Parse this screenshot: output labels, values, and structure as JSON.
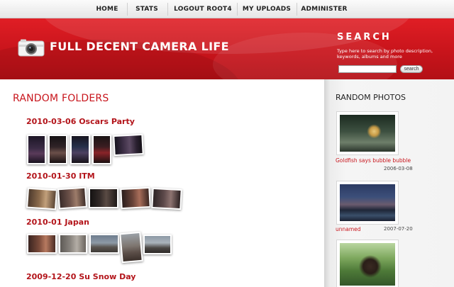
{
  "nav": {
    "items": [
      "HOME",
      "STATS",
      "LOGOUT ROOT4",
      "MY UPLOADS",
      "ADMINISTER"
    ]
  },
  "header": {
    "site_title": "FULL DECENT CAMERA LIFE",
    "logo_icon": "camera-icon",
    "brand_color": "#d0161d"
  },
  "search": {
    "title": "SEARCH",
    "hint": "Type here to search by photo description, keywords, albums and more",
    "value": "",
    "button_label": "search"
  },
  "main": {
    "title": "RANDOM FOLDERS",
    "folders": [
      {
        "title": "2010-03-06 Oscars Party"
      },
      {
        "title": "2010-01-30 ITM"
      },
      {
        "title": "2010-01 Japan"
      },
      {
        "title": "2009-12-20 Su Snow Day"
      }
    ]
  },
  "sidebar": {
    "title": "RANDOM PHOTOS",
    "photos": [
      {
        "caption": "Goldfish says bubble bubble",
        "date": "2006-03-08"
      },
      {
        "caption": "unnamed",
        "date": "2007-07-20"
      },
      {
        "caption": "",
        "date": ""
      }
    ]
  }
}
